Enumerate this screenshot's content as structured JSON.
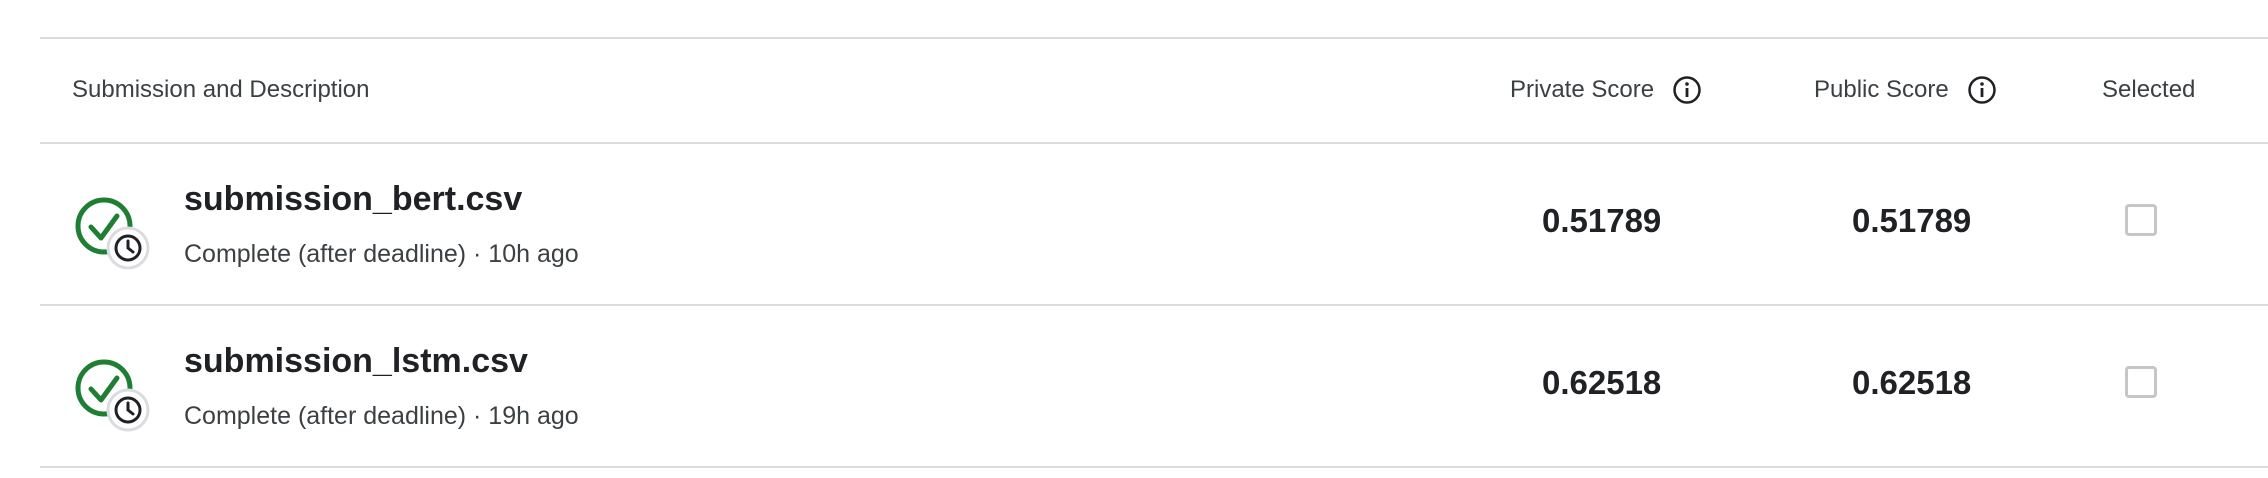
{
  "table": {
    "headers": {
      "description": "Submission and Description",
      "private_score": "Private Score",
      "public_score": "Public Score",
      "selected": "Selected"
    },
    "rows": [
      {
        "filename": "submission_bert.csv",
        "status": "Complete (after deadline) · 10h ago",
        "private_score": "0.51789",
        "public_score": "0.51789",
        "selected": false
      },
      {
        "filename": "submission_lstm.csv",
        "status": "Complete (after deadline) · 19h ago",
        "private_score": "0.62518",
        "public_score": "0.62518",
        "selected": false
      }
    ]
  },
  "icons": {
    "status": "check-circle-clock-icon",
    "info": "info-icon"
  },
  "colors": {
    "success_green": "#1e7e34",
    "divider": "#dadce0"
  }
}
